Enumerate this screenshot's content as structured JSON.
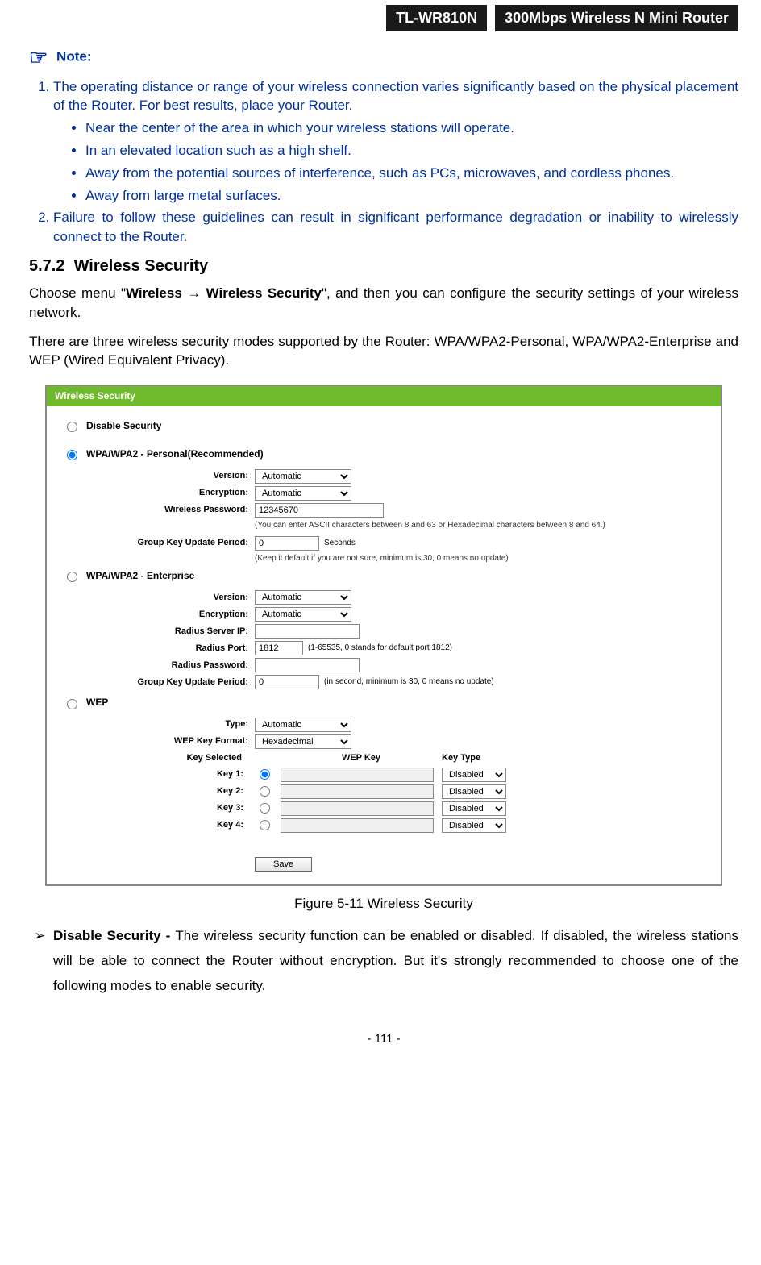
{
  "header": {
    "model": "TL-WR810N",
    "product": "300Mbps Wireless N Mini Router"
  },
  "note": {
    "label": "Note:",
    "item1": "The operating distance or range of your wireless connection varies significantly based on the physical placement of the Router. For best results, place your Router.",
    "bullets": [
      "Near the center of the area in which your wireless stations will operate.",
      "In an elevated location such as a high shelf.",
      "Away from the potential sources of interference, such as PCs, microwaves, and cordless phones.",
      "Away from large metal surfaces."
    ],
    "item2": "Failure to follow these guidelines can result in significant performance degradation or inability to wirelessly connect to the Router."
  },
  "section": {
    "num": "5.7.2",
    "title": "Wireless Security",
    "para1_a": "Choose menu \"",
    "para1_b": "Wireless → Wireless Security",
    "para1_c": "\", and then you can configure the security settings of your wireless network.",
    "para2": "There are three wireless security modes supported by the Router: WPA/WPA2-Personal, WPA/WPA2-Enterprise and WEP (Wired Equivalent Privacy)."
  },
  "figure": {
    "title": "Wireless Security",
    "disable": "Disable Security",
    "personal": {
      "label": "WPA/WPA2 - Personal(Recommended)",
      "version_lbl": "Version:",
      "version_val": "Automatic",
      "enc_lbl": "Encryption:",
      "enc_val": "Automatic",
      "pwd_lbl": "Wireless Password:",
      "pwd_val": "12345670",
      "pwd_hint": "(You can enter ASCII characters between 8 and 63 or Hexadecimal characters between 8 and 64.)",
      "gkup_lbl": "Group Key Update Period:",
      "gkup_val": "0",
      "gkup_after": "Seconds",
      "gkup_hint": "(Keep it default if you are not sure, minimum is 30, 0 means no update)"
    },
    "enterprise": {
      "label": "WPA/WPA2 - Enterprise",
      "version_lbl": "Version:",
      "version_val": "Automatic",
      "enc_lbl": "Encryption:",
      "enc_val": "Automatic",
      "rip_lbl": "Radius Server IP:",
      "rport_lbl": "Radius Port:",
      "rport_val": "1812",
      "rport_after": "(1-65535, 0 stands for default port 1812)",
      "rpwd_lbl": "Radius Password:",
      "gkup_lbl": "Group Key Update Period:",
      "gkup_val": "0",
      "gkup_after": "(in second, minimum is 30, 0 means no update)"
    },
    "wep": {
      "label": "WEP",
      "type_lbl": "Type:",
      "type_val": "Automatic",
      "fmt_lbl": "WEP Key Format:",
      "fmt_val": "Hexadecimal",
      "col_sel": "Key Selected",
      "col_key": "WEP Key",
      "col_type": "Key Type",
      "k1": "Key 1:",
      "k2": "Key 2:",
      "k3": "Key 3:",
      "k4": "Key 4:",
      "disabled": "Disabled"
    },
    "save": "Save",
    "caption": "Figure 5-11 Wireless Security"
  },
  "after": {
    "ds_label": "Disable Security - ",
    "ds_text": "The wireless security function can be enabled or disabled. If disabled, the wireless stations will be able to connect the Router without encryption. But it's strongly recommended to choose one of the following modes to enable security."
  },
  "footer": "- 111 -"
}
